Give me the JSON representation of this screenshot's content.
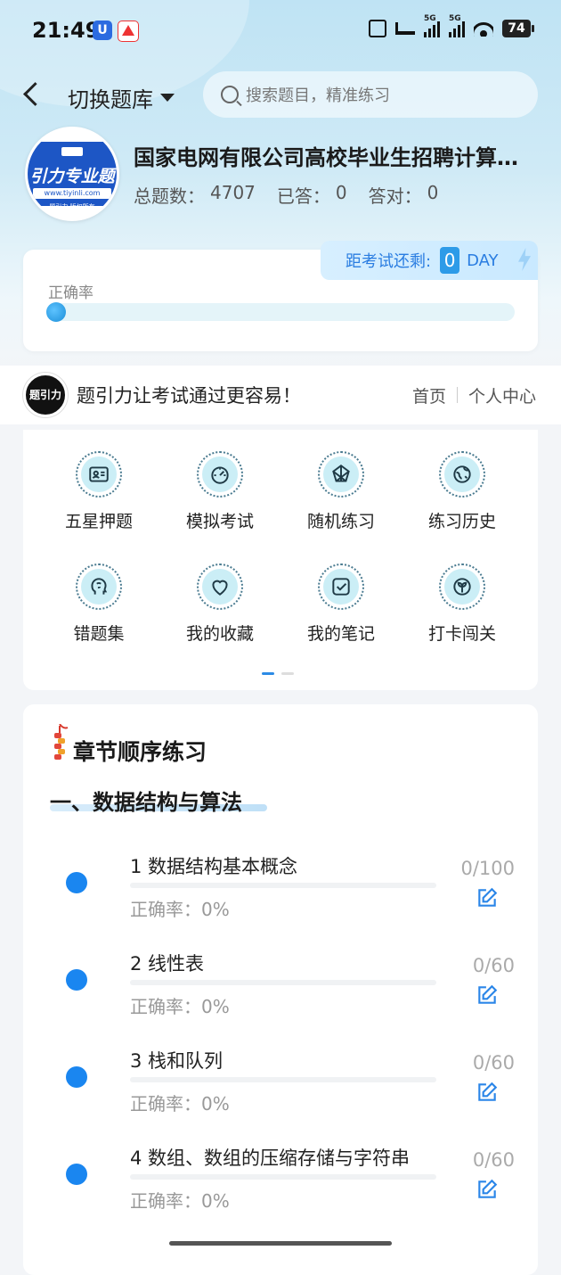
{
  "status_bar": {
    "time": "21:49",
    "battery": "74",
    "signal_tag_1": "5G",
    "signal_tag_2": "5G"
  },
  "header": {
    "back_label": "",
    "switch_label": "切换题库",
    "search_placeholder": "搜索题目，精准练习"
  },
  "course": {
    "logo_text": "引力专业题",
    "logo_url": "www.tiyinli.com",
    "logo_footer": "题引力 版权所有",
    "title": "国家电网有限公司高校毕业生招聘计算机类",
    "total_label": "总题数：",
    "total": "4707",
    "answered_label": "已答：",
    "answered": "0",
    "correct_label": "答对：",
    "correct": "0"
  },
  "accuracy": {
    "label": "正确率",
    "value_fraction": 0,
    "countdown_label": "距考试还剩:",
    "countdown_days": "0",
    "countdown_unit": "DAY"
  },
  "banner": {
    "logo_text": "题引力",
    "slogan": "题引力让考试通过更容易！",
    "home_link": "首页",
    "profile_link": "个人中心"
  },
  "features": [
    {
      "label": "五星押题",
      "icon": "id-card-icon"
    },
    {
      "label": "模拟考试",
      "icon": "gauge-icon"
    },
    {
      "label": "随机练习",
      "icon": "random-icon"
    },
    {
      "label": "练习历史",
      "icon": "history-icon"
    },
    {
      "label": "错题集",
      "icon": "brain-icon"
    },
    {
      "label": "我的收藏",
      "icon": "heart-icon"
    },
    {
      "label": "我的笔记",
      "icon": "note-icon"
    },
    {
      "label": "打卡闯关",
      "icon": "leaf-icon"
    }
  ],
  "pager": {
    "pages": 2,
    "current": 1
  },
  "chapters": {
    "heading": "章节顺序练习",
    "section_title": "一、数据结构与算法",
    "items": [
      {
        "name": "1 数据结构基本概念",
        "accuracy": "正确率：0%",
        "count": "0/100",
        "progress": 0
      },
      {
        "name": "2 线性表",
        "accuracy": "正确率：0%",
        "count": "0/60",
        "progress": 0
      },
      {
        "name": "3 栈和队列",
        "accuracy": "正确率：0%",
        "count": "0/60",
        "progress": 0
      },
      {
        "name": "4 数组、数组的压缩存储与字符串",
        "accuracy": "正确率：0%",
        "count": "0/60",
        "progress": 0
      }
    ]
  },
  "colors": {
    "accent": "#1a86f0",
    "icon_bg": "#cbeef6",
    "countdown_text": "#2a7de1"
  }
}
